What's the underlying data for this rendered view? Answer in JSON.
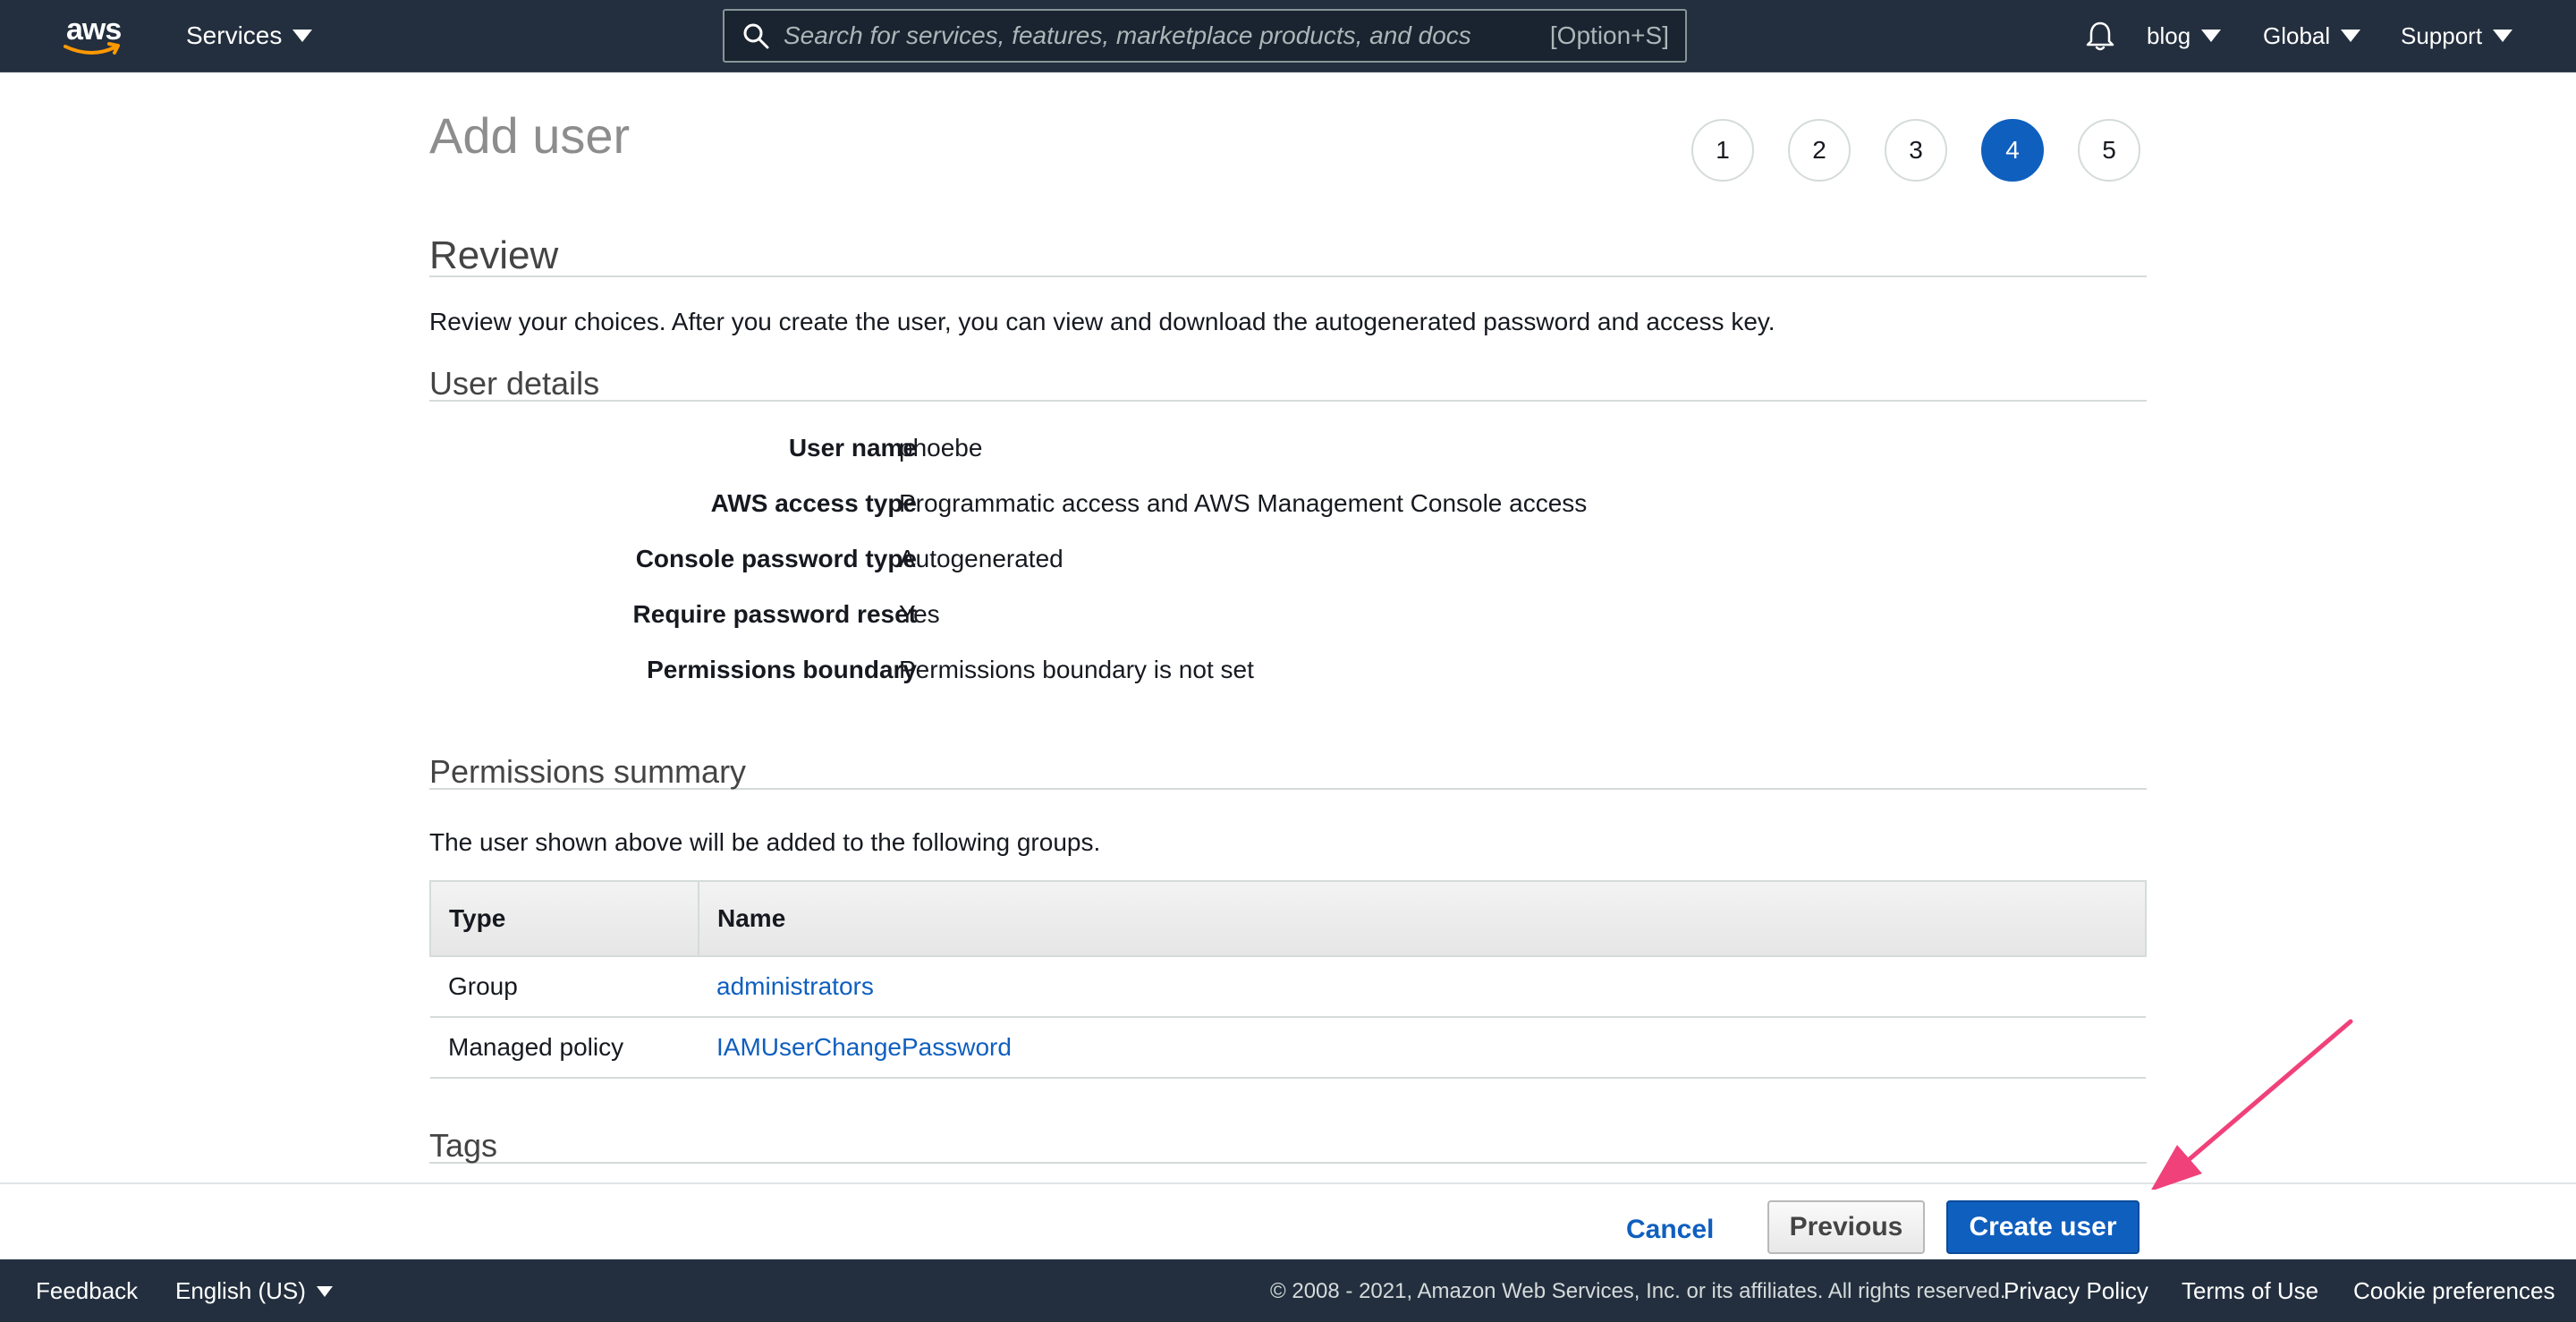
{
  "nav": {
    "logo_text": "aws",
    "services_label": "Services",
    "search_placeholder": "Search for services, features, marketplace products, and docs",
    "search_shortcut": "[Option+S]",
    "account_label": "blog",
    "region_label": "Global",
    "support_label": "Support"
  },
  "page": {
    "title": "Add user",
    "steps": [
      "1",
      "2",
      "3",
      "4",
      "5"
    ],
    "active_step": 4
  },
  "review": {
    "heading": "Review",
    "description": "Review your choices. After you create the user, you can view and download the autogenerated password and access key."
  },
  "user_details": {
    "heading": "User details",
    "rows": [
      {
        "label": "User name",
        "value": "phoebe"
      },
      {
        "label": "AWS access type",
        "value": "Programmatic access and AWS Management Console access"
      },
      {
        "label": "Console password type",
        "value": "Autogenerated"
      },
      {
        "label": "Require password reset",
        "value": "Yes"
      },
      {
        "label": "Permissions boundary",
        "value": "Permissions boundary is not set"
      }
    ]
  },
  "permissions": {
    "heading": "Permissions summary",
    "description": "The user shown above will be added to the following groups.",
    "columns": [
      "Type",
      "Name"
    ],
    "rows": [
      {
        "type": "Group",
        "name": "administrators"
      },
      {
        "type": "Managed policy",
        "name": "IAMUserChangePassword"
      }
    ]
  },
  "tags": {
    "heading": "Tags"
  },
  "actions": {
    "cancel_label": "Cancel",
    "previous_label": "Previous",
    "create_label": "Create user"
  },
  "footer": {
    "feedback_label": "Feedback",
    "language_label": "English (US)",
    "copyright": "© 2008 - 2021, Amazon Web Services, Inc. or its affiliates. All rights reserved.",
    "privacy_label": "Privacy Policy",
    "terms_label": "Terms of Use",
    "cookie_label": "Cookie preferences"
  },
  "colors": {
    "nav_bg": "#232f3e",
    "accent_blue": "#0f5fbf",
    "arrow_pink": "#f0417a",
    "aws_smile": "#ff9900"
  }
}
